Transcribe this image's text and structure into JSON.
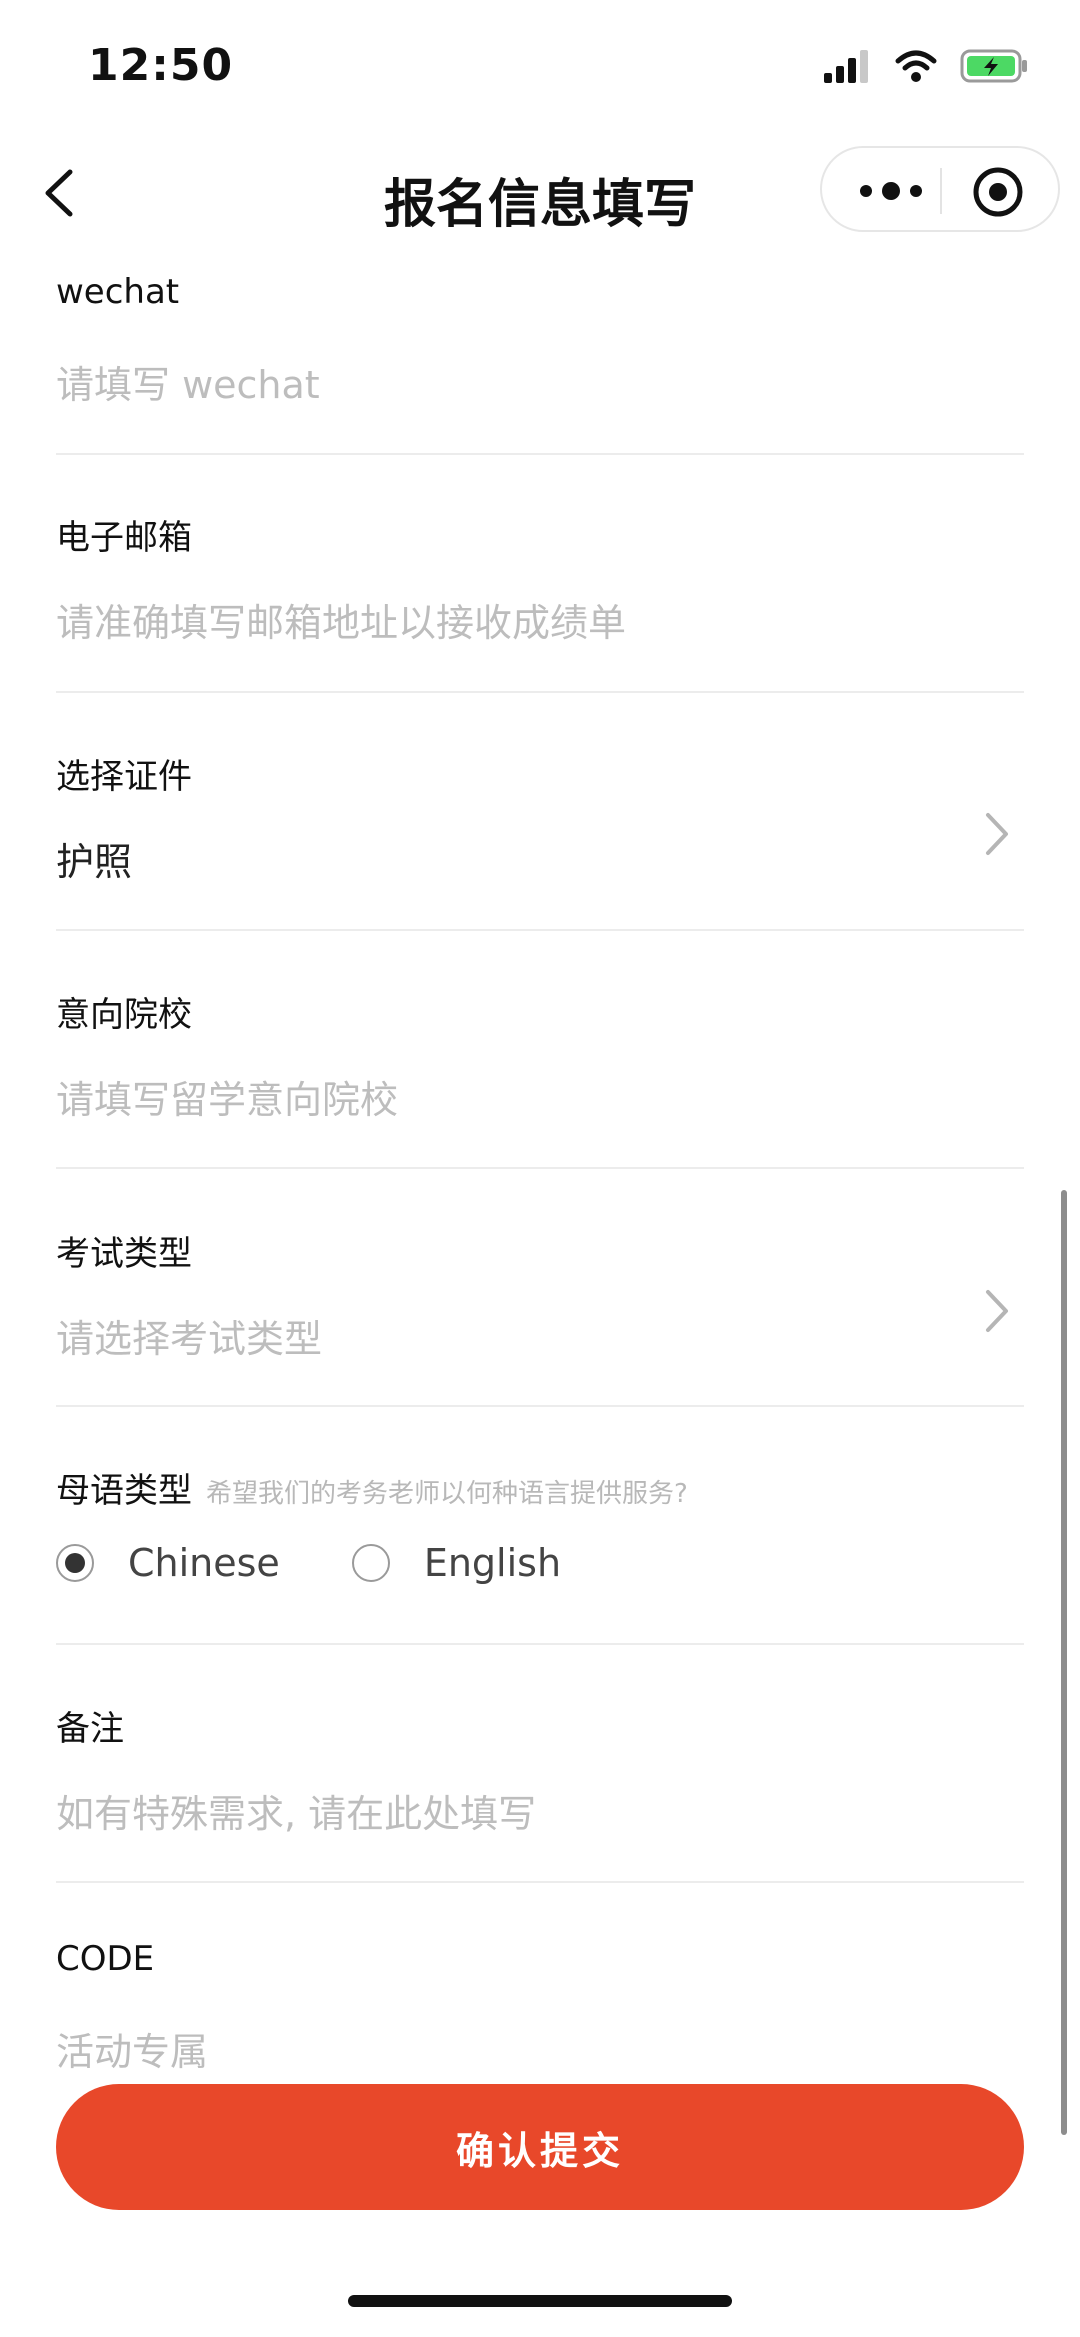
{
  "status_bar": {
    "time": "12:50"
  },
  "nav": {
    "title": "报名信息填写"
  },
  "form": {
    "wechat": {
      "label": "wechat",
      "placeholder": "请填写 wechat"
    },
    "email": {
      "label": "电子邮箱",
      "placeholder": "请准确填写邮箱地址以接收成绩单"
    },
    "id_type": {
      "label": "选择证件",
      "value": "护照"
    },
    "school": {
      "label": "意向院校",
      "placeholder": "请填写留学意向院校"
    },
    "exam_type": {
      "label": "考试类型",
      "placeholder": "请选择考试类型"
    },
    "native_language": {
      "label": "母语类型",
      "hint": "希望我们的考务老师以何种语言提供服务?",
      "options": [
        {
          "label": "Chinese",
          "selected": true
        },
        {
          "label": "English",
          "selected": false
        }
      ]
    },
    "remarks": {
      "label": "备注",
      "placeholder": "如有特殊需求, 请在此处填写"
    },
    "code": {
      "label": "CODE",
      "placeholder": "活动专属"
    }
  },
  "submit": {
    "label": "确认提交"
  },
  "colors": {
    "accent": "#e8482a",
    "placeholder": "#bdbdbd",
    "battery": "#4cd964"
  },
  "icons": [
    "back-chevron-icon",
    "more-dots-icon",
    "target-icon",
    "chevron-right-icon",
    "signal-icon",
    "wifi-icon",
    "battery-icon"
  ]
}
